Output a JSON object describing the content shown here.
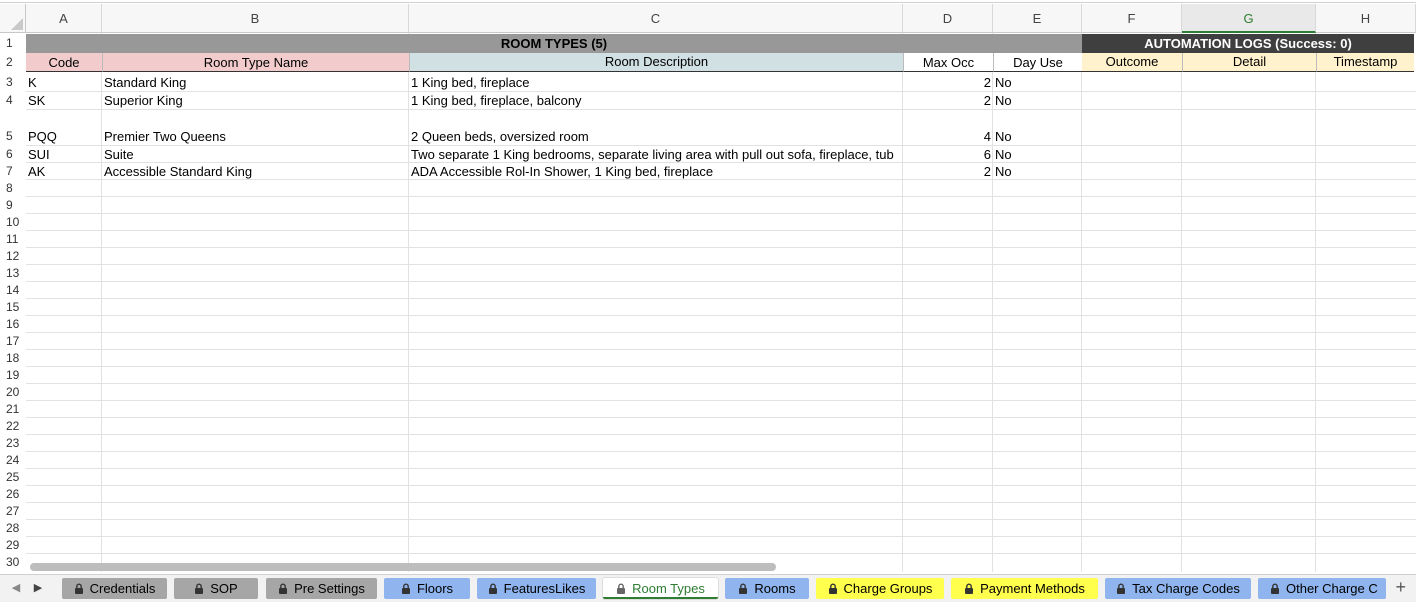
{
  "columns": [
    "A",
    "B",
    "C",
    "D",
    "E",
    "F",
    "G",
    "H"
  ],
  "rows": [
    "1",
    "2",
    "3",
    "4",
    "5",
    "6",
    "7",
    "8",
    "9",
    "10",
    "11",
    "12",
    "13",
    "14",
    "15",
    "16",
    "17",
    "18",
    "19",
    "20",
    "21",
    "22",
    "23",
    "24",
    "25",
    "26",
    "27",
    "28",
    "29",
    "30"
  ],
  "room_types": {
    "title": "ROOM TYPES (5)",
    "headers": [
      "Code",
      "Room Type Name",
      "Room Description",
      "Max Occ",
      "Day Use"
    ],
    "rows": [
      {
        "code": "K",
        "name": "Standard King",
        "description": "1 King bed, fireplace",
        "max_occ": "2",
        "day_use": "No"
      },
      {
        "code": "SK",
        "name": "Superior King",
        "description": "1 King bed, fireplace, balcony",
        "max_occ": "2",
        "day_use": "No"
      },
      {
        "code": "PQQ",
        "name": "Premier Two Queens",
        "description": "2 Queen beds, oversized room",
        "max_occ": "4",
        "day_use": "No"
      },
      {
        "code": "SUI",
        "name": "Suite",
        "description": "Two separate 1 King bedrooms, separate living area with pull out sofa, fireplace, tub",
        "max_occ": "6",
        "day_use": "No"
      },
      {
        "code": "AK",
        "name": "Accessible Standard King",
        "description": "ADA Accessible Rol-In Shower, 1 King bed, fireplace",
        "max_occ": "2",
        "day_use": "No"
      }
    ]
  },
  "automation_logs": {
    "title": "AUTOMATION LOGS (Success: 0)",
    "headers": [
      "Outcome",
      "Detail",
      "Timestamp"
    ]
  },
  "tabs": [
    {
      "label": "Credentials",
      "locked": true,
      "color": "#a6a6a6",
      "active": false
    },
    {
      "label": "SOP",
      "locked": true,
      "color": "#a6a6a6",
      "active": false
    },
    {
      "label": "Pre Settings",
      "locked": true,
      "color": "#a6a6a6",
      "active": false
    },
    {
      "label": "Floors",
      "locked": true,
      "color": "#8fb4ee",
      "active": false
    },
    {
      "label": "FeaturesLikes",
      "locked": true,
      "color": "#8fb4ee",
      "active": false
    },
    {
      "label": "Room Types",
      "locked": true,
      "color": "#ffffff",
      "active": true
    },
    {
      "label": "Rooms",
      "locked": true,
      "color": "#8fb4ee",
      "active": false
    },
    {
      "label": "Charge Groups",
      "locked": true,
      "color": "#ffff4d",
      "active": false
    },
    {
      "label": "Payment Methods",
      "locked": true,
      "color": "#ffff4d",
      "active": false
    },
    {
      "label": "Tax Charge Codes",
      "locked": true,
      "color": "#8fb4ee",
      "active": false
    },
    {
      "label": "Other Charge C",
      "locked": true,
      "color": "#8fb4ee",
      "active": false
    }
  ],
  "colors": {
    "title_bar": "#989898",
    "logs_title_bar": "#3f3f3f",
    "code_header": "#f2cccc",
    "desc_header": "#d0e0e3",
    "logs_header": "#fff2cc",
    "active_tab_text": "#2e7d32"
  },
  "icons": {
    "lock": "lock-icon",
    "prev": "chevron-left-icon",
    "next": "chevron-right-icon",
    "add": "plus-icon"
  }
}
